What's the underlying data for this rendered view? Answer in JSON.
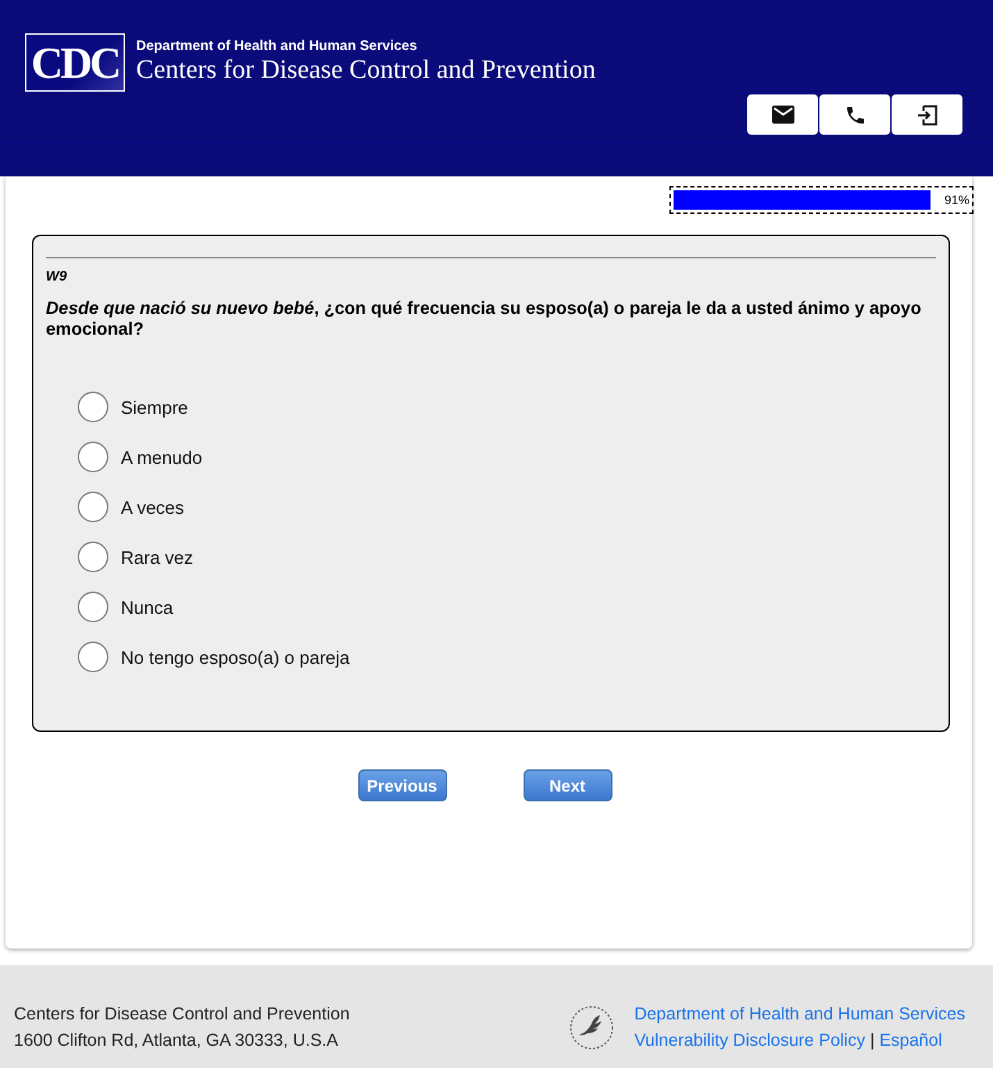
{
  "header": {
    "logo": "CDC",
    "department": "Department of Health and Human Services",
    "agency": "Centers for Disease Control and Prevention",
    "actions": [
      {
        "kind": "mail"
      },
      {
        "kind": "phone"
      },
      {
        "kind": "exit"
      }
    ]
  },
  "progress": {
    "level": 0.91,
    "label": "91%"
  },
  "question": {
    "code": "W9",
    "text": "*Desde que nació su nuevo bebé*, ¿con qué frecuencia su esposo(a) o pareja le da a usted ánimo y apoyo emocional?",
    "options": [
      {
        "label": "Siempre",
        "selected": false
      },
      {
        "label": "A menudo",
        "selected": false
      },
      {
        "label": "A veces",
        "selected": false
      },
      {
        "label": "Rara vez",
        "selected": false
      },
      {
        "label": "Nunca",
        "selected": false
      },
      {
        "label": "No tengo esposo(a) o pareja",
        "selected": false
      }
    ]
  },
  "buttons": [
    "Previous",
    "Next"
  ],
  "footer": {
    "name": "Centers for Disease Control and Prevention",
    "address": "1600 Clifton Rd, Atlanta, GA 30333, U.S.A",
    "links": [
      "Department of Health and Human Services",
      "Vulnerability Disclosure Policy",
      "Español"
    ],
    "separator": "|"
  }
}
